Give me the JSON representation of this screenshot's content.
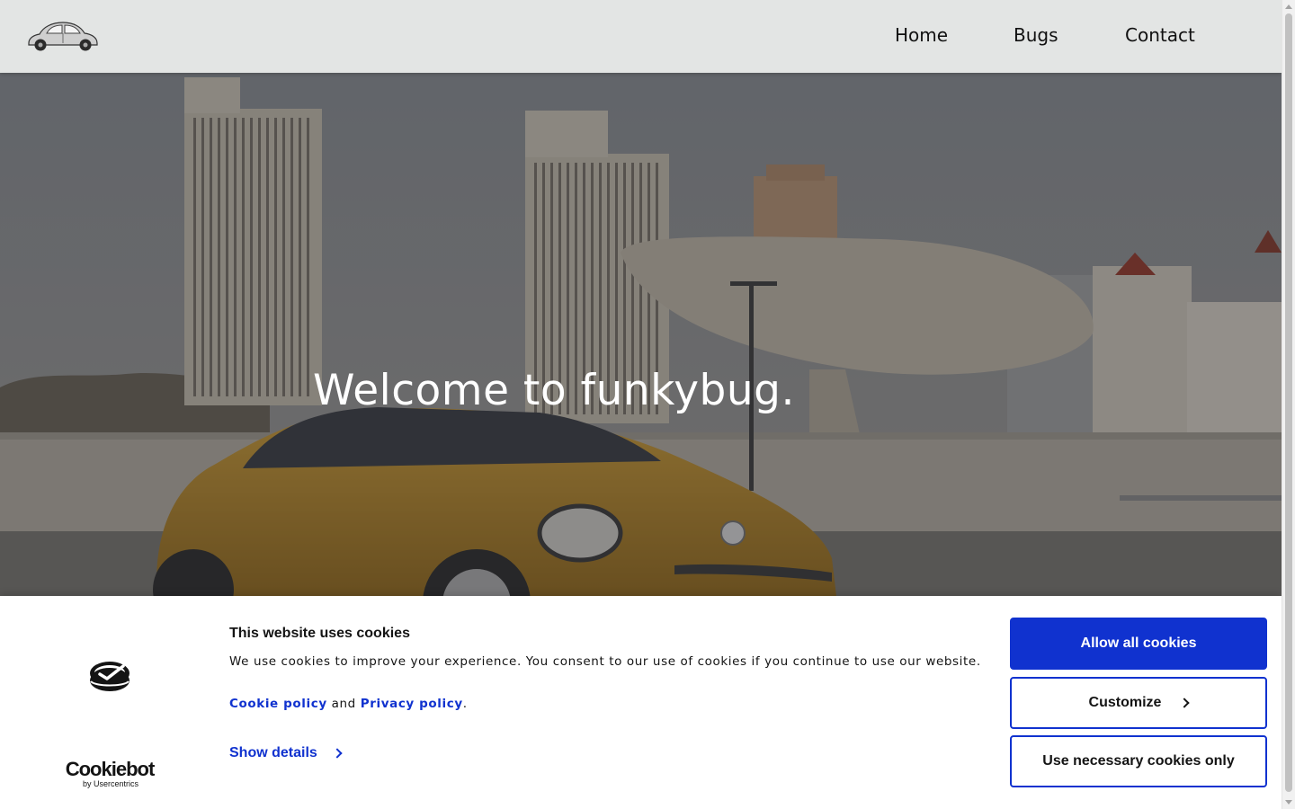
{
  "header": {
    "logo_icon": "beetle-car-logo",
    "nav": {
      "home": "Home",
      "bugs": "Bugs",
      "contact": "Contact"
    }
  },
  "hero": {
    "title": "Welcome to funkybug."
  },
  "cookie_banner": {
    "brand_name": "Cookiebot",
    "brand_sub": "by Usercentrics",
    "title": "This website uses cookies",
    "text": "We use cookies to improve your experience. You consent to our use of cookies if you continue to use our website.",
    "cookie_policy_link": "Cookie policy",
    "and_text": "and",
    "privacy_policy_link": "Privacy policy",
    "period": ".",
    "show_details": "Show details",
    "allow_all": "Allow all cookies",
    "customize": "Customize",
    "necessary_only": "Use necessary cookies only",
    "accent_color": "#1032cf"
  }
}
